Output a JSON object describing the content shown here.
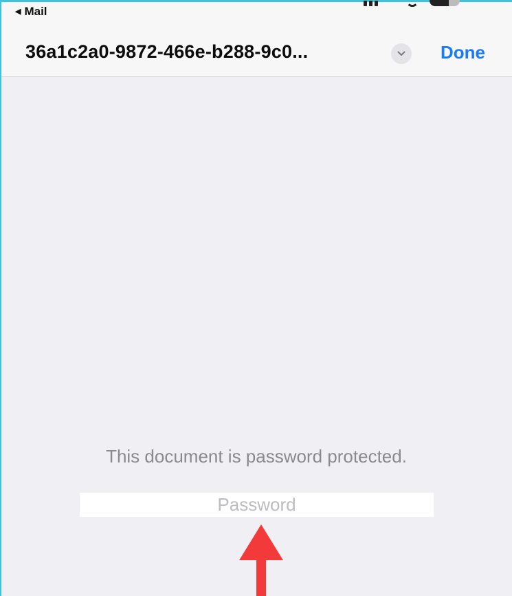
{
  "header": {
    "back_label": "Mail",
    "title": "36a1c2a0-9872-466e-b288-9c0...",
    "done_label": "Done",
    "accent_color": "#1a7cf4"
  },
  "content": {
    "message": "This document is password protected.",
    "password_placeholder": "Password",
    "password_value": ""
  },
  "annotation": {
    "arrow_color": "#f23a3a"
  }
}
